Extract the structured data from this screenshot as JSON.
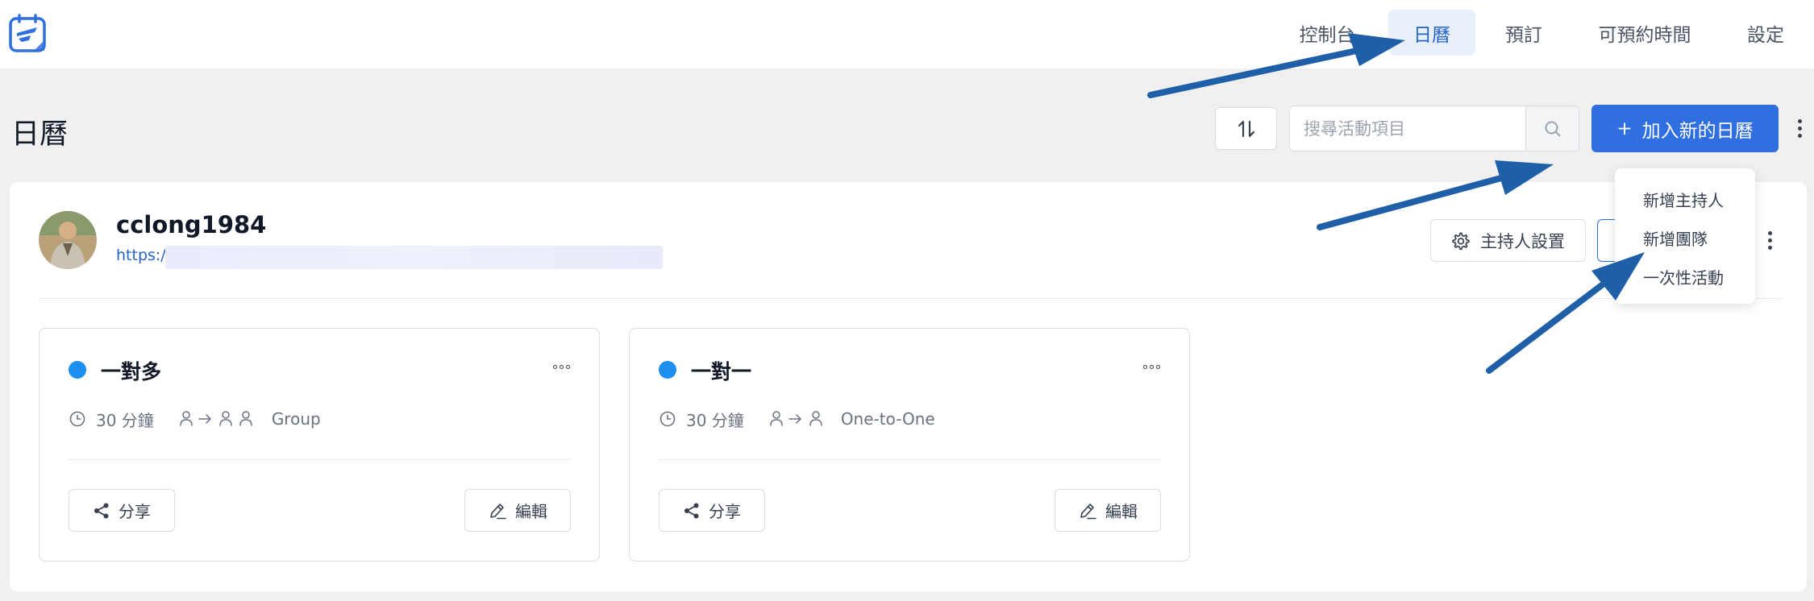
{
  "nav": {
    "items": [
      {
        "label": "控制台"
      },
      {
        "label": "日曆"
      },
      {
        "label": "預訂"
      },
      {
        "label": "可預約時間"
      },
      {
        "label": "設定"
      }
    ],
    "active_index": 1
  },
  "page": {
    "title": "日曆"
  },
  "toolbar": {
    "search_placeholder": "搜尋活動項目",
    "add_button_label": "加入新的日曆",
    "add_button_plus": "+"
  },
  "user": {
    "name": "cclong1984",
    "link_visible": "https:/",
    "host_settings_label": "主持人設置"
  },
  "dropdown": {
    "items": [
      {
        "label": "新增主持人"
      },
      {
        "label": "新增團隊"
      },
      {
        "label": "一次性活動"
      }
    ]
  },
  "events": [
    {
      "title": "一對多",
      "duration": "30 分鐘",
      "type": "Group",
      "share_label": "分享",
      "edit_label": "編輯",
      "dot_color": "#1d8ff0"
    },
    {
      "title": "一對一",
      "duration": "30 分鐘",
      "type": "One-to-One",
      "share_label": "分享",
      "edit_label": "編輯",
      "dot_color": "#1d8ff0"
    }
  ],
  "colors": {
    "primary": "#2f6fe0",
    "active_nav_bg": "#e8f0fc",
    "annotation_arrow": "#1f5fa8"
  }
}
